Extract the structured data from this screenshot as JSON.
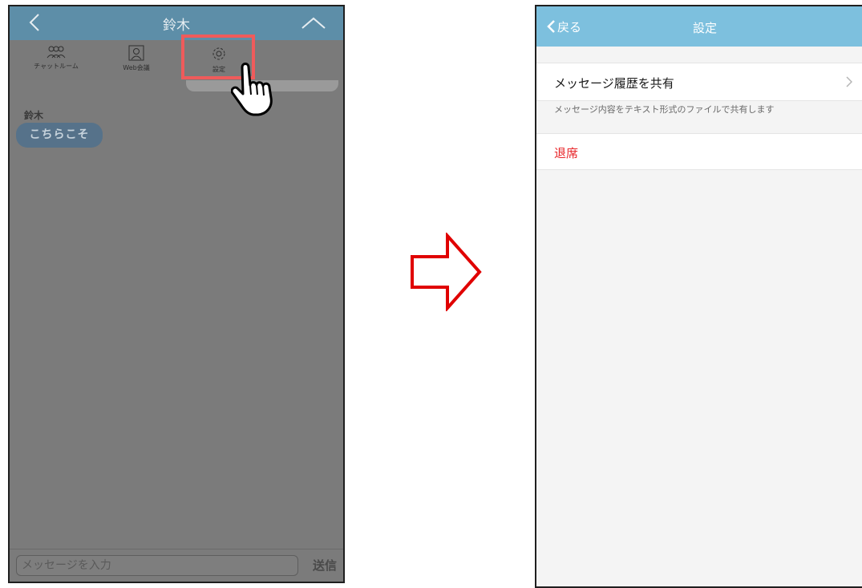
{
  "left": {
    "header": {
      "title": "鈴木"
    },
    "menu": [
      {
        "label": "チャットルーム",
        "icon": "group-icon"
      },
      {
        "label": "Web会議",
        "icon": "person-frame-icon"
      },
      {
        "label": "設定",
        "icon": "gear-icon"
      }
    ],
    "message": {
      "sender": "鈴木",
      "text": "こちらこそ"
    },
    "input": {
      "placeholder": "メッセージを入力"
    },
    "send_label": "送信"
  },
  "right": {
    "header": {
      "back_label": "戻る",
      "title": "設定"
    },
    "rows": [
      {
        "label": "メッセージ履歴を共有",
        "description": "メッセージ内容をテキスト形式のファイルで共有します"
      },
      {
        "label": "退席"
      }
    ]
  },
  "colors": {
    "highlight": "#ef5b5b",
    "arrow": "#e00000",
    "header_right": "#7dc0de",
    "leave_text": "#e8262a"
  }
}
